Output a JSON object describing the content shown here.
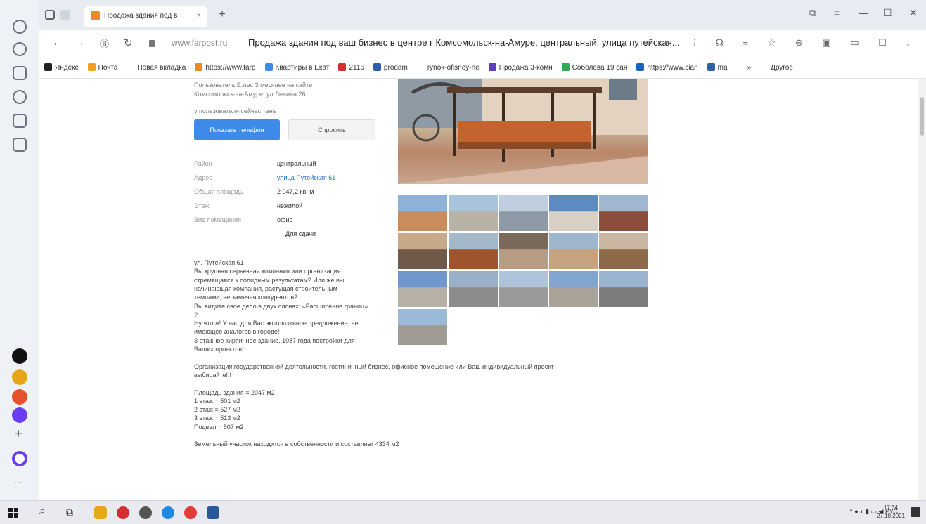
{
  "browser": {
    "tab_title": "Продажа здания под в",
    "tab_close": "×",
    "new_tab": "+",
    "url_domain": "www.farpost.ru",
    "page_title": "Продажа здания под ваш бизнес в центре г Комсомольск-на-Амуре, центральный, улица путейская...",
    "bookmarks": [
      {
        "label": "Яндекс",
        "color": "#222222"
      },
      {
        "label": "Почта",
        "color": "#f0a01c"
      },
      {
        "label": "Новая вкладка",
        "color": "#ffffff"
      },
      {
        "label": "https://www.farp",
        "color": "#f08a1c"
      },
      {
        "label": "Квартиры в Екат",
        "color": "#3d8ae8"
      },
      {
        "label": "2116",
        "color": "#d32f2f"
      },
      {
        "label": "prodam",
        "color": "#2f5fa8"
      },
      {
        "label": "rynok-ofisnoy-ne",
        "color": "#ffffff"
      },
      {
        "label": "Продажа 3-комн",
        "color": "#5b3fb8"
      },
      {
        "label": "Соболева 19 сан",
        "color": "#34a853"
      },
      {
        "label": "https://www.cian",
        "color": "#1565c0"
      },
      {
        "label": "ma",
        "color": "#2f5fa8"
      },
      {
        "label": "»",
        "color": "#ffffff"
      },
      {
        "label": "Другое",
        "color": "#ffffff"
      }
    ]
  },
  "listing": {
    "author_line": "Пользователь Е.лес 3 месяцев на сайте",
    "city_line": "Комсомольск-на-Амуре, ул Ленина 26",
    "online_line": "у пользователя сейчас тень",
    "show_phone_button": "Показать телефон",
    "ask_button": "Спросить",
    "properties": [
      {
        "label": "Район",
        "value": "центральный",
        "link": false
      },
      {
        "label": "Адрес",
        "value": "улица Путейская 61",
        "link": true
      },
      {
        "label": "Общая площадь",
        "value": "2 047,2 кв. м",
        "link": false
      },
      {
        "label": "Этаж",
        "value": "нежилой",
        "link": false
      },
      {
        "label": "Вид помещения",
        "value": "офис",
        "link": false
      },
      {
        "label": "",
        "value": "Для сдачи",
        "link": false
      }
    ],
    "description": [
      "ул. Путейская 61",
      "Вы крупная серьезная компания или организация",
      "стремящаяся к солидным результатам? Или же вы",
      "начинающая компания, растущая строительным",
      "темпами, не замечая конкурентов?",
      "Вы видите свое дело в двух словах: «Расширение границ»",
      "?",
      "Ну что ж! У нас для Вас эксклюзивное предложение, не",
      "имеющее аналогов в городе!",
      "3-этажное кирпичное здание, 1987 года постройки для",
      "Ваших проектов!",
      "",
      "Организация государственной деятельности, гостиничный бизнес, офисное помещение или Ваш индивидуальный проект -",
      "выбирайте!!!",
      "",
      "Площадь здания = 2047 м2",
      "1 этаж = 501 м2",
      "2 этаж = 527 м2",
      "3 этаж = 513 м2",
      "Подвал = 507 м2",
      "",
      "Земельный участок находится в собственности и составляет 4334 м2"
    ]
  },
  "taskbar": {
    "tray_text": "РУС",
    "time": "17:34",
    "date": "27.10.2021"
  }
}
